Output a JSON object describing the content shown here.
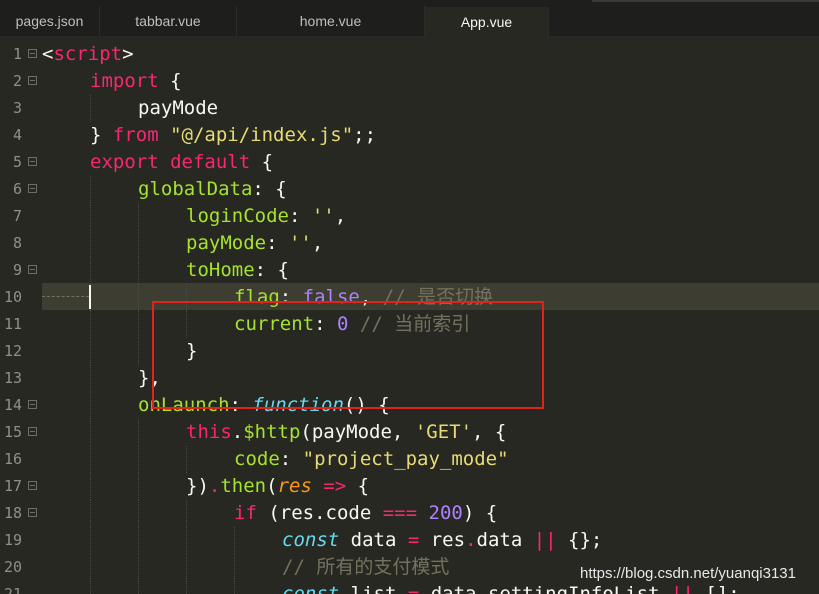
{
  "tabs": [
    {
      "label": "pages.json",
      "active": false
    },
    {
      "label": "tabbar.vue",
      "active": false
    },
    {
      "label": "home.vue",
      "active": false
    },
    {
      "label": "App.vue",
      "active": true
    }
  ],
  "editor": {
    "current_line": 10,
    "highlight_box": {
      "color": "#e0241b",
      "lines": [
        9,
        12
      ]
    },
    "lines": [
      {
        "n": "1",
        "fold": true,
        "indent": 0,
        "tokens": [
          {
            "t": "<",
            "c": "id"
          },
          {
            "t": "script",
            "c": "tag"
          },
          {
            "t": ">",
            "c": "id"
          }
        ]
      },
      {
        "n": "2",
        "fold": true,
        "indent": 1,
        "tokens": [
          {
            "t": "import",
            "c": "kw"
          },
          {
            "t": " {",
            "c": "id"
          }
        ]
      },
      {
        "n": "3",
        "fold": false,
        "indent": 2,
        "tokens": [
          {
            "t": "payMode",
            "c": "id"
          }
        ]
      },
      {
        "n": "4",
        "fold": false,
        "indent": 1,
        "tokens": [
          {
            "t": "} ",
            "c": "id"
          },
          {
            "t": "from",
            "c": "kw"
          },
          {
            "t": " ",
            "c": "id"
          },
          {
            "t": "\"@/api/index.js\"",
            "c": "str"
          },
          {
            "t": ";;",
            "c": "id"
          }
        ]
      },
      {
        "n": "5",
        "fold": true,
        "indent": 1,
        "tokens": [
          {
            "t": "export",
            "c": "kw"
          },
          {
            "t": " ",
            "c": "id"
          },
          {
            "t": "default",
            "c": "kw"
          },
          {
            "t": " {",
            "c": "id"
          }
        ]
      },
      {
        "n": "6",
        "fold": true,
        "indent": 2,
        "tokens": [
          {
            "t": "globalData",
            "c": "prop"
          },
          {
            "t": ": {",
            "c": "id"
          }
        ]
      },
      {
        "n": "7",
        "fold": false,
        "indent": 3,
        "tokens": [
          {
            "t": "loginCode",
            "c": "prop"
          },
          {
            "t": ": ",
            "c": "id"
          },
          {
            "t": "''",
            "c": "str"
          },
          {
            "t": ",",
            "c": "id"
          }
        ]
      },
      {
        "n": "8",
        "fold": false,
        "indent": 3,
        "tokens": [
          {
            "t": "payMode",
            "c": "prop"
          },
          {
            "t": ": ",
            "c": "id"
          },
          {
            "t": "''",
            "c": "str"
          },
          {
            "t": ",",
            "c": "id"
          }
        ]
      },
      {
        "n": "9",
        "fold": true,
        "indent": 3,
        "tokens": [
          {
            "t": "toHome",
            "c": "prop"
          },
          {
            "t": ": {",
            "c": "id"
          }
        ]
      },
      {
        "n": "10",
        "fold": false,
        "indent": 4,
        "tokens": [
          {
            "t": "flag",
            "c": "prop"
          },
          {
            "t": ": ",
            "c": "id"
          },
          {
            "t": "false",
            "c": "const"
          },
          {
            "t": ", ",
            "c": "id"
          },
          {
            "t": "// 是否切换",
            "c": "cmt"
          }
        ]
      },
      {
        "n": "11",
        "fold": false,
        "indent": 4,
        "tokens": [
          {
            "t": "current",
            "c": "prop"
          },
          {
            "t": ": ",
            "c": "id"
          },
          {
            "t": "0",
            "c": "const"
          },
          {
            "t": " ",
            "c": "id"
          },
          {
            "t": "// 当前索引",
            "c": "cmt"
          }
        ]
      },
      {
        "n": "12",
        "fold": false,
        "indent": 3,
        "tokens": [
          {
            "t": "}",
            "c": "id"
          }
        ]
      },
      {
        "n": "13",
        "fold": false,
        "indent": 2,
        "tokens": [
          {
            "t": "},",
            "c": "id"
          }
        ]
      },
      {
        "n": "14",
        "fold": true,
        "indent": 2,
        "tokens": [
          {
            "t": "onLaunch",
            "c": "prop"
          },
          {
            "t": ": ",
            "c": "id"
          },
          {
            "t": "function",
            "c": "func"
          },
          {
            "t": "() {",
            "c": "id"
          }
        ]
      },
      {
        "n": "15",
        "fold": true,
        "indent": 3,
        "tokens": [
          {
            "t": "this",
            "c": "kw"
          },
          {
            "t": ".",
            "c": "id"
          },
          {
            "t": "$http",
            "c": "prop"
          },
          {
            "t": "(payMode, ",
            "c": "id"
          },
          {
            "t": "'GET'",
            "c": "str"
          },
          {
            "t": ", {",
            "c": "id"
          }
        ]
      },
      {
        "n": "16",
        "fold": false,
        "indent": 4,
        "tokens": [
          {
            "t": "code",
            "c": "prop"
          },
          {
            "t": ": ",
            "c": "id"
          },
          {
            "t": "\"project_pay_mode\"",
            "c": "str"
          }
        ]
      },
      {
        "n": "17",
        "fold": true,
        "indent": 3,
        "tokens": [
          {
            "t": "})",
            "c": "id"
          },
          {
            "t": ".",
            "c": "kw"
          },
          {
            "t": "then",
            "c": "prop"
          },
          {
            "t": "(",
            "c": "id"
          },
          {
            "t": "res",
            "c": "param"
          },
          {
            "t": " ",
            "c": "id"
          },
          {
            "t": "=>",
            "c": "kw"
          },
          {
            "t": " {",
            "c": "id"
          }
        ]
      },
      {
        "n": "18",
        "fold": true,
        "indent": 4,
        "tokens": [
          {
            "t": "if",
            "c": "kw"
          },
          {
            "t": " (res.code ",
            "c": "id"
          },
          {
            "t": "===",
            "c": "kw"
          },
          {
            "t": " ",
            "c": "id"
          },
          {
            "t": "200",
            "c": "const"
          },
          {
            "t": ") {",
            "c": "id"
          }
        ]
      },
      {
        "n": "19",
        "fold": false,
        "indent": 5,
        "tokens": [
          {
            "t": "const",
            "c": "func"
          },
          {
            "t": " data ",
            "c": "id"
          },
          {
            "t": "=",
            "c": "kw"
          },
          {
            "t": " res",
            "c": "id"
          },
          {
            "t": ".",
            "c": "kw"
          },
          {
            "t": "data ",
            "c": "id"
          },
          {
            "t": "||",
            "c": "kw"
          },
          {
            "t": " {};",
            "c": "id"
          }
        ]
      },
      {
        "n": "20",
        "fold": false,
        "indent": 5,
        "tokens": [
          {
            "t": "// 所有的支付模式",
            "c": "cmt"
          }
        ]
      },
      {
        "n": "21",
        "fold": false,
        "indent": 5,
        "tokens": [
          {
            "t": "const",
            "c": "func"
          },
          {
            "t": " list ",
            "c": "id"
          },
          {
            "t": "=",
            "c": "kw"
          },
          {
            "t": " data",
            "c": "id"
          },
          {
            "t": ".",
            "c": "kw"
          },
          {
            "t": "settingInfoList ",
            "c": "id"
          },
          {
            "t": "||",
            "c": "kw"
          },
          {
            "t": " [];",
            "c": "id"
          }
        ]
      }
    ]
  },
  "watermark": "https://blog.csdn.net/yuanqi3131"
}
